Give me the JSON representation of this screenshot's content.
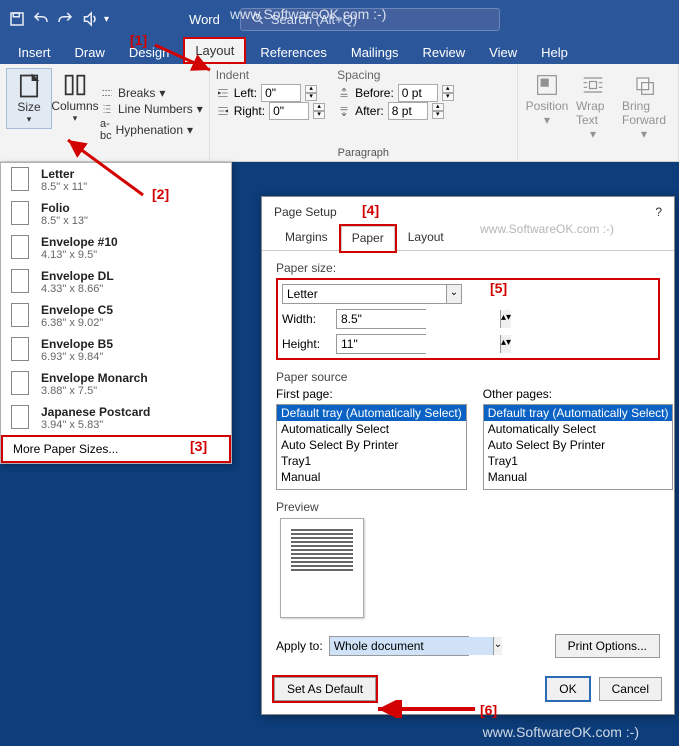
{
  "watermark_top": "www.SoftwareOK.com :-)",
  "watermark_bottom": "www.SoftwareOK.com :-)",
  "watermark_dialog": "www.SoftwareOK.com :-)",
  "app_title": "Word",
  "search_placeholder": "Search (Alt+Q)",
  "tabs": [
    "Insert",
    "Draw",
    "Design",
    "Layout",
    "References",
    "Mailings",
    "Review",
    "View",
    "Help"
  ],
  "active_tab": "Layout",
  "ribbon": {
    "size": "Size",
    "columns": "Columns",
    "breaks": "Breaks",
    "line_numbers": "Line Numbers",
    "hyphenation": "Hyphenation",
    "indent_label": "Indent",
    "spacing_label": "Spacing",
    "left_label": "Left:",
    "right_label": "Right:",
    "before_label": "Before:",
    "after_label": "After:",
    "left_val": "0\"",
    "right_val": "0\"",
    "before_val": "0 pt",
    "after_val": "8 pt",
    "paragraph_label": "Paragraph",
    "position": "Position",
    "wrap_text": "Wrap Text",
    "bring_forward": "Bring Forward"
  },
  "size_menu": {
    "items": [
      {
        "name": "Letter",
        "dims": "8.5\" x 11\""
      },
      {
        "name": "Folio",
        "dims": "8.5\" x 13\""
      },
      {
        "name": "Envelope #10",
        "dims": "4.13\" x 9.5\""
      },
      {
        "name": "Envelope DL",
        "dims": "4.33\" x 8.66\""
      },
      {
        "name": "Envelope C5",
        "dims": "6.38\" x 9.02\""
      },
      {
        "name": "Envelope B5",
        "dims": "6.93\" x 9.84\""
      },
      {
        "name": "Envelope Monarch",
        "dims": "3.88\" x 7.5\""
      },
      {
        "name": "Japanese Postcard",
        "dims": "3.94\" x 5.83\""
      }
    ],
    "more": "More Paper Sizes..."
  },
  "dialog": {
    "title": "Page Setup",
    "help": "?",
    "tabs": [
      "Margins",
      "Paper",
      "Layout"
    ],
    "active_tab": "Paper",
    "paper_size_label": "Paper size:",
    "paper_size_value": "Letter",
    "width_label": "Width:",
    "width_value": "8.5\"",
    "height_label": "Height:",
    "height_value": "11\"",
    "source_label": "Paper source",
    "first_page_label": "First page:",
    "other_pages_label": "Other pages:",
    "tray_options": [
      "Default tray (Automatically Select)",
      "Automatically Select",
      "Auto Select By Printer",
      "Tray1",
      "Manual"
    ],
    "preview_label": "Preview",
    "apply_to_label": "Apply to:",
    "apply_to_value": "Whole document",
    "print_options": "Print Options...",
    "set_default": "Set As Default",
    "ok": "OK",
    "cancel": "Cancel"
  },
  "annotations": {
    "a1": "[1]",
    "a2": "[2]",
    "a3": "[3]",
    "a4": "[4]",
    "a5": "[5]",
    "a6": "[6]"
  }
}
